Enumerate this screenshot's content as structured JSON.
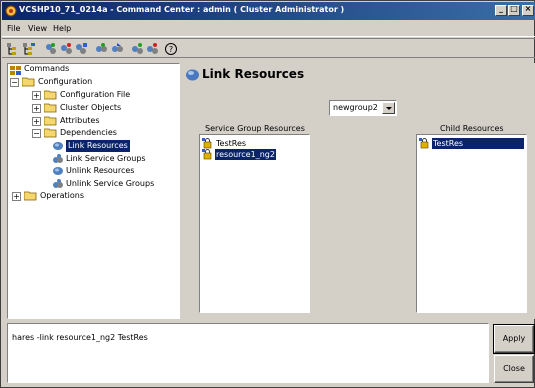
{
  "window": {
    "title": "VCSHP10_71_0214a - Command Center : admin ( Cluster Administrator )",
    "controls": [
      "_",
      "□",
      "×"
    ]
  },
  "menubar": {
    "items": [
      {
        "label": "File",
        "hotkey": "F"
      },
      {
        "label": "View",
        "hotkey": "V"
      },
      {
        "label": "Help",
        "hotkey": "H"
      }
    ]
  },
  "toolbar": {
    "icons": [
      "expand-tree-icon",
      "collapse-tree-icon",
      "link-icon",
      "unlink-icon",
      "resource-icon",
      "group-link-icon",
      "group-unlink-icon",
      "online-icon",
      "offline-icon",
      "help-icon"
    ]
  },
  "tree": {
    "root": "Commands",
    "configuration": "Configuration",
    "configuration_file": "Configuration File",
    "cluster_objects": "Cluster Objects",
    "attributes": "Attributes",
    "dependencies": "Dependencies",
    "link_resources": "Link Resources",
    "link_service_groups": "Link Service Groups",
    "unlink_resources": "Unlink Resources",
    "unlink_service_groups": "Unlink Service Groups",
    "operations": "Operations"
  },
  "main": {
    "heading": "Link Resources",
    "group_select": "newgroup2",
    "service_group_resources_label": "Service Group Resources",
    "child_resources_label": "Child Resources",
    "service_group_resources": [
      {
        "label": "TestRes",
        "selected": false
      },
      {
        "label": "resource1_ng2",
        "selected": true
      }
    ],
    "child_resources": [
      {
        "label": "TestRes",
        "selected": true
      }
    ]
  },
  "command": {
    "text": "hares -link resource1_ng2 TestRes"
  },
  "buttons": {
    "apply": "Apply",
    "close": "Close"
  },
  "colors": {
    "title_bar": "#0a246a",
    "selection": "#0a246a",
    "face": "#d4d0c8"
  }
}
